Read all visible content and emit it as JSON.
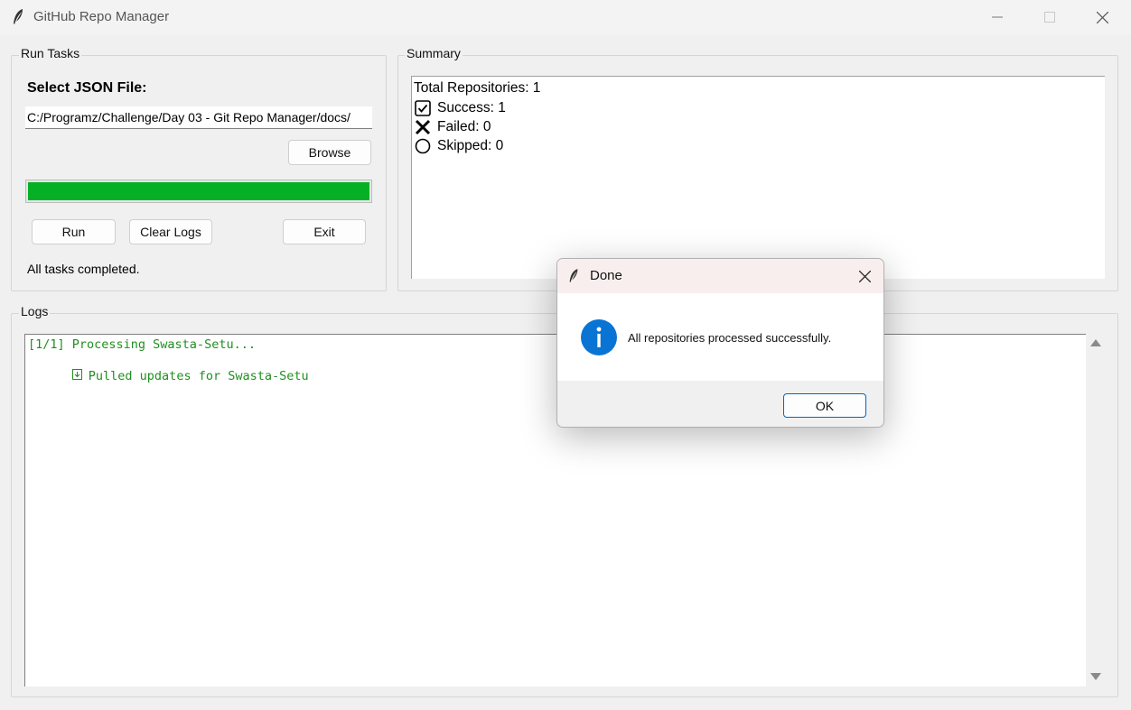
{
  "window": {
    "title": "GitHub Repo Manager",
    "icon": "feather-icon"
  },
  "run_tasks": {
    "group_label": "Run Tasks",
    "select_label": "Select JSON File:",
    "file_path": "C:/Programz/Challenge/Day 03 - Git Repo Manager/docs/",
    "browse_label": "Browse",
    "progress_percent": 100,
    "progress_color": "#06b025",
    "run_label": "Run",
    "clear_logs_label": "Clear Logs",
    "exit_label": "Exit",
    "status": "All tasks completed."
  },
  "summary": {
    "group_label": "Summary",
    "total": "Total Repositories: 1",
    "success": "Success: 1",
    "failed": "Failed: 0",
    "skipped": "Skipped: 0"
  },
  "logs": {
    "group_label": "Logs",
    "lines": [
      "[1/1] Processing Swasta-Setu...",
      "Pulled updates for Swasta-Setu"
    ],
    "text_color": "#1f8f1f"
  },
  "dialog": {
    "title": "Done",
    "message": "All repositories processed successfully.",
    "ok_label": "OK",
    "icon": "info-icon",
    "accent": "#0078d4"
  }
}
